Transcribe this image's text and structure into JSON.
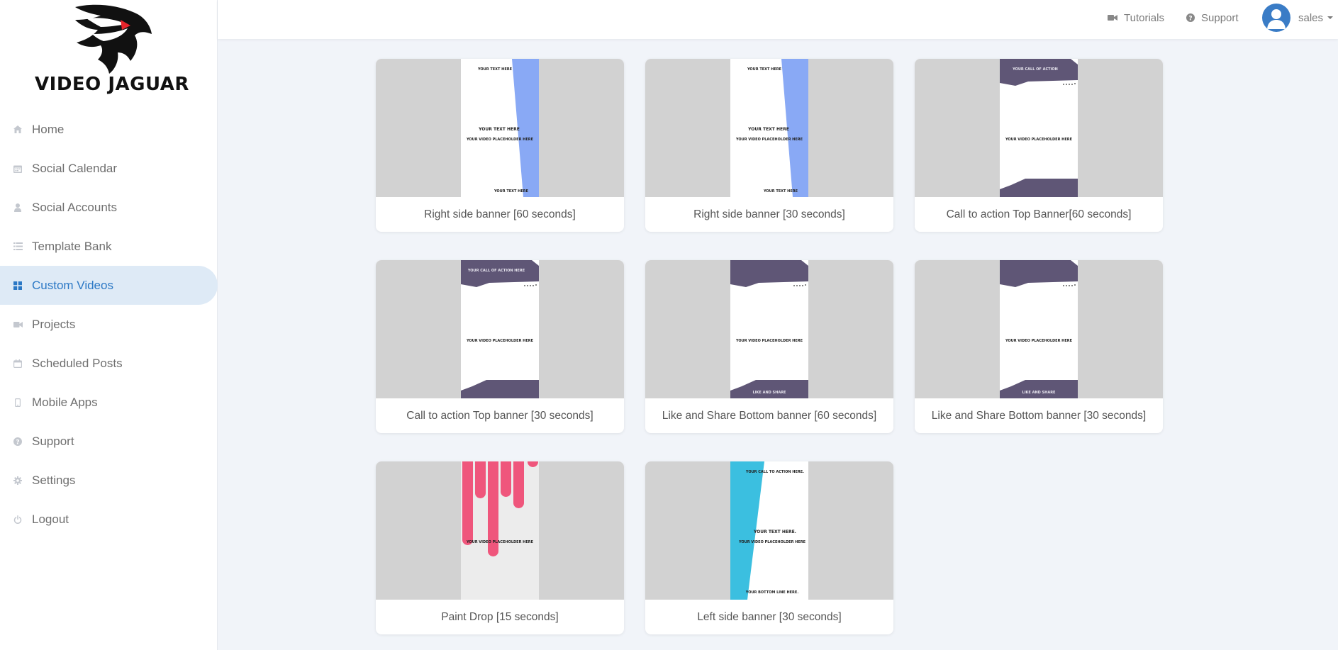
{
  "brand": {
    "name": "VIDEO JAGUAR"
  },
  "sidebar": {
    "items": [
      {
        "label": "Home",
        "icon": "home-icon",
        "active": false
      },
      {
        "label": "Social Calendar",
        "icon": "calendar-icon",
        "active": false
      },
      {
        "label": "Social Accounts",
        "icon": "user-icon",
        "active": false
      },
      {
        "label": "Template Bank",
        "icon": "list-icon",
        "active": false
      },
      {
        "label": "Custom Videos",
        "icon": "grid-icon",
        "active": true
      },
      {
        "label": "Projects",
        "icon": "video-camera-icon",
        "active": false
      },
      {
        "label": "Scheduled Posts",
        "icon": "calendar-empty-icon",
        "active": false
      },
      {
        "label": "Mobile Apps",
        "icon": "mobile-icon",
        "active": false
      },
      {
        "label": "Support",
        "icon": "question-circle-icon",
        "active": false
      },
      {
        "label": "Settings",
        "icon": "gear-icon",
        "active": false
      },
      {
        "label": "Logout",
        "icon": "power-icon",
        "active": false
      }
    ]
  },
  "topbar": {
    "tutorials_label": "Tutorials",
    "support_label": "Support",
    "user_name": "sales"
  },
  "colors": {
    "active_bg": "#deeaf6",
    "active_text": "#2b78c5",
    "banner_blue": "#89a9f5",
    "banner_purple": "#5f5676",
    "paint_pink": "#ef567c",
    "left_cyan": "#3bbfe0"
  },
  "templates": [
    {
      "label": "Right side banner [60 seconds]",
      "style": "right-banner",
      "text_top": "YOUR TEXT HERE",
      "text_mid": "YOUR TEXT HERE",
      "placeholder": "YOUR VIDEO PLACEHOLDER HERE",
      "text_bottom": "YOUR TEXT HERE"
    },
    {
      "label": "Right side banner [30 seconds]",
      "style": "right-banner",
      "text_top": "YOUR TEXT HERE",
      "text_mid": "YOUR TEXT HERE",
      "placeholder": "YOUR VIDEO PLACEHOLDER HERE",
      "text_bottom": "YOUR TEXT HERE"
    },
    {
      "label": "Call to action Top Banner[60 seconds]",
      "style": "cta-top",
      "text_top": "YOUR CALL OF ACTION",
      "placeholder": "YOUR VIDEO PLACEHOLDER HERE"
    },
    {
      "label": "Call to action Top banner [30 seconds]",
      "style": "cta-top",
      "text_top": "YOUR CALL OF ACTION HERE",
      "placeholder": "YOUR VIDEO PLACEHOLDER HERE"
    },
    {
      "label": "Like and Share Bottom banner [60 seconds]",
      "style": "like-share",
      "placeholder": "YOUR VIDEO PLACEHOLDER HERE",
      "text_bottom": "LIKE AND SHARE"
    },
    {
      "label": "Like and Share Bottom banner [30 seconds]",
      "style": "like-share",
      "placeholder": "YOUR VIDEO PLACEHOLDER HERE",
      "text_bottom": "LIKE AND SHARE"
    },
    {
      "label": "Paint Drop [15 seconds]",
      "style": "paint-drop",
      "placeholder": "YOUR VIDEO PLACEHOLDER HERE"
    },
    {
      "label": "Left side banner [30 seconds]",
      "style": "left-banner",
      "text_top": "YOUR CALL TO ACTION HERE.",
      "text_mid": "YOUR TEXT HERE.",
      "placeholder": "YOUR VIDEO PLACEHOLDER HERE",
      "text_bottom": "YOUR BOTTOM LINE HERE."
    }
  ]
}
